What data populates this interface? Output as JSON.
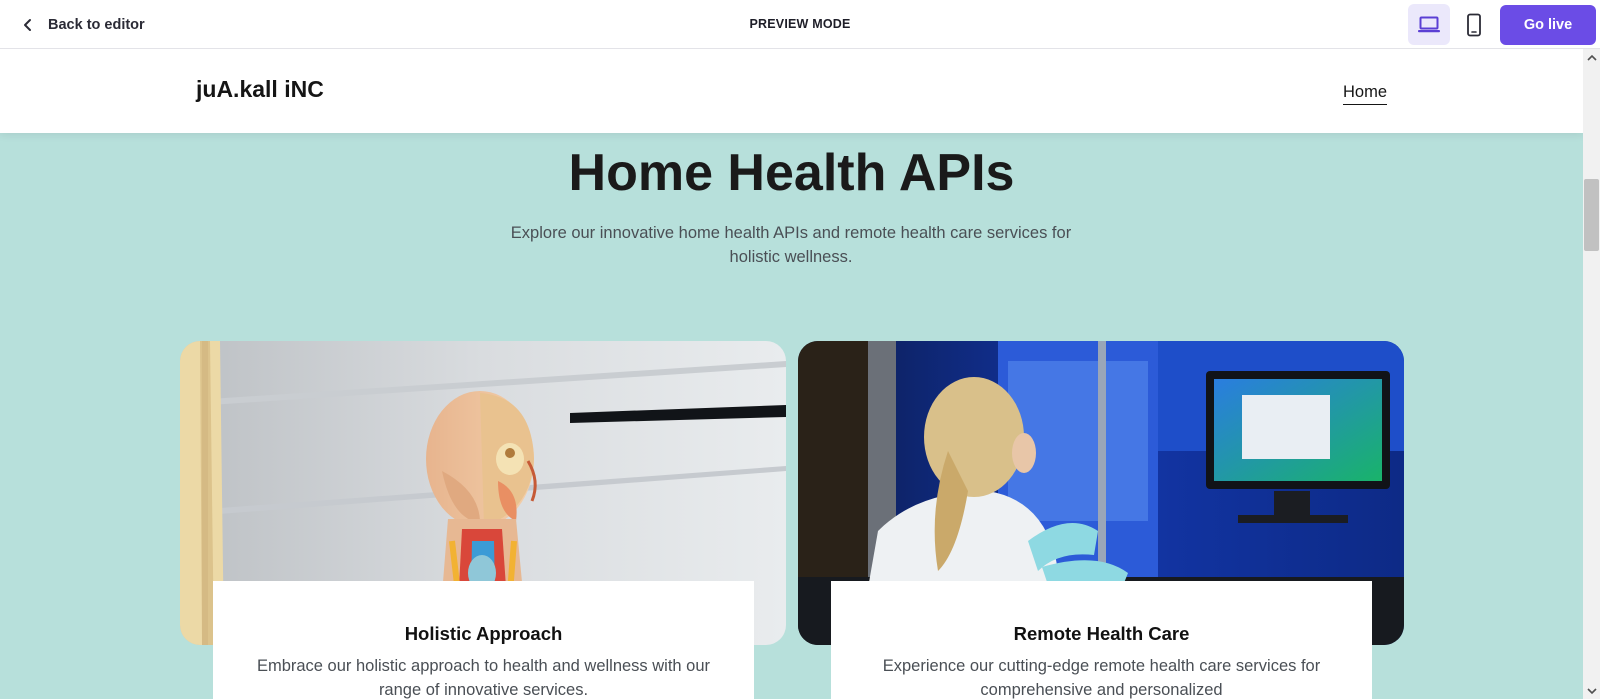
{
  "editor": {
    "back_label": "Back to editor",
    "mode_label": "PREVIEW MODE",
    "go_live_label": "Go live",
    "accent_color": "#6b4ce6",
    "active_device": "desktop",
    "icons": {
      "back": "chevron-left-icon",
      "desktop": "laptop-icon",
      "mobile": "smartphone-icon"
    }
  },
  "site": {
    "brand": "juA.kall iNC",
    "nav": [
      {
        "label": "Home",
        "active": true
      }
    ],
    "background_color": "#b7e0db",
    "hero": {
      "title": "Home Health APIs",
      "subtitle": "Explore our innovative home health APIs and remote health care services for holistic wellness."
    },
    "cards": [
      {
        "title": "Holistic Approach",
        "text": "Embrace our holistic approach to health and wellness with our range of innovative services.",
        "image": "anatomical-head-model-photo"
      },
      {
        "title": "Remote Health Care",
        "text": "Experience our cutting-edge remote health care services for comprehensive and personalized",
        "image": "lab-technician-photo"
      }
    ]
  }
}
